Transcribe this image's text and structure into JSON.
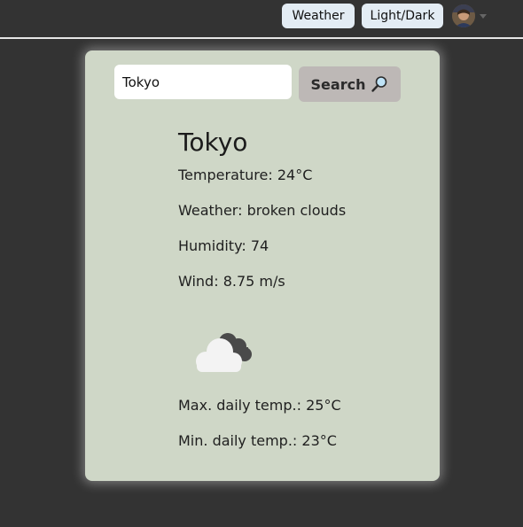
{
  "nav": {
    "weather_label": "Weather",
    "theme_label": "Light/Dark"
  },
  "search": {
    "value": "Tokyo",
    "button_label": "Search"
  },
  "weather": {
    "city": "Tokyo",
    "temperature": "Temperature: 24°C",
    "description": "Weather: broken clouds",
    "humidity": "Humidity: 74",
    "wind": "Wind: 8.75 m/s",
    "max_temp": "Max. daily temp.: 25°C",
    "min_temp": "Min. daily temp.: 23°C",
    "icon": "broken-clouds-icon"
  },
  "colors": {
    "page_bg": "#333333",
    "card_bg": "#cfd7c7",
    "nav_button_bg": "#e3ecf4",
    "search_button_bg": "#bdb8b6"
  }
}
